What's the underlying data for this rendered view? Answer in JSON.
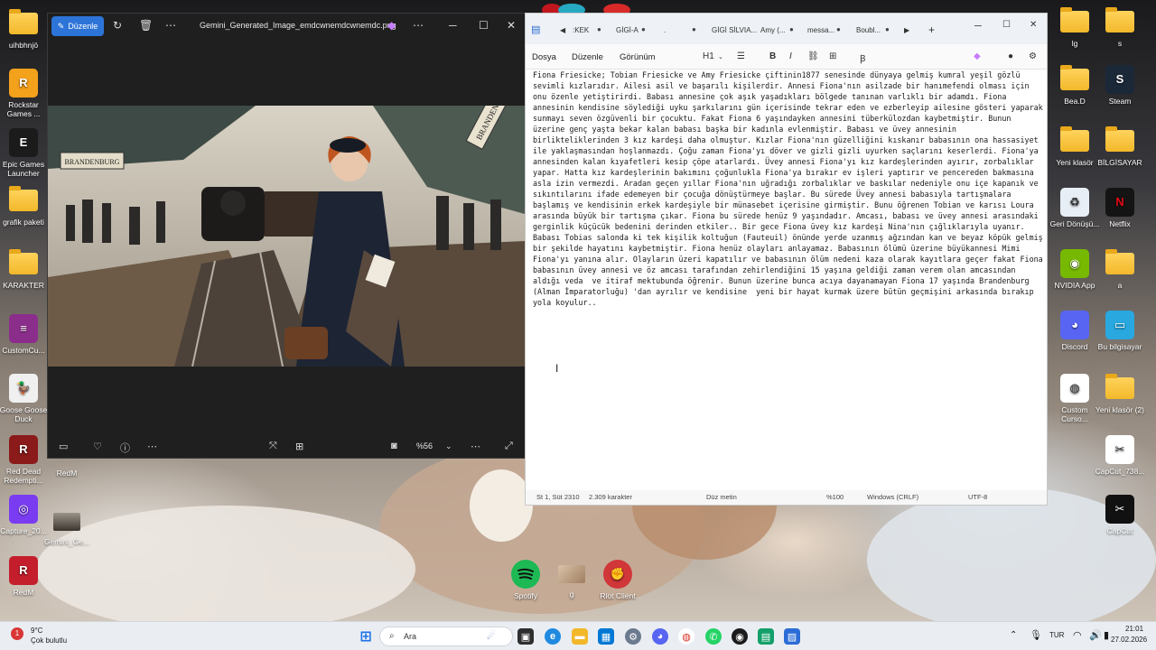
{
  "desktop": {
    "left_icons": [
      {
        "label": "uihbhnjö",
        "kind": "folder"
      },
      {
        "label": "Rockstar Games ...",
        "kind": "app",
        "icon": "rockstar-icon",
        "color": "#f4a11c",
        "glyph": "R"
      },
      {
        "label": "Epic Games Launcher",
        "kind": "app",
        "icon": "epic-games-icon",
        "color": "#1b1b1b",
        "glyph": "E"
      },
      {
        "label": "grafik paketi",
        "kind": "folder"
      },
      {
        "label": "KARAKTER",
        "kind": "folder"
      },
      {
        "label": "CustomCu...",
        "kind": "app",
        "icon": "winrar-icon",
        "color": "#8b2d8b",
        "glyph": "≡"
      },
      {
        "label": "Goose Goose Duck",
        "kind": "app",
        "icon": "goose-icon",
        "color": "#f0f0f0",
        "glyph": "🦆"
      },
      {
        "label": "Red Dead Redempti...",
        "kind": "app",
        "icon": "red-dead-icon",
        "color": "#8b1a1a",
        "glyph": "R"
      },
      {
        "label": "Capture_20...",
        "kind": "app",
        "icon": "capture-icon",
        "color": "#7a3cf0",
        "glyph": "◎"
      },
      {
        "label": "RedM",
        "kind": "app",
        "icon": "redm-icon",
        "color": "#c41e2c",
        "glyph": "R"
      }
    ],
    "mid_icons": [
      {
        "label": "RedM",
        "icon": "redm-icon"
      },
      {
        "label": "Gemini_Ge...",
        "icon": "image-file-icon"
      }
    ],
    "right_icons": [
      {
        "label": "lg",
        "kind": "folder"
      },
      {
        "label": "s",
        "kind": "folder"
      },
      {
        "label": "Bea.D",
        "kind": "folder"
      },
      {
        "label": "Steam",
        "kind": "app",
        "icon": "steam-icon",
        "color": "#1b2838",
        "glyph": "S"
      },
      {
        "label": "Yeni klasör",
        "kind": "folder"
      },
      {
        "label": "BİLGİSAYAR",
        "kind": "folder"
      },
      {
        "label": "Geri Dönüşü...",
        "kind": "app",
        "icon": "recycle-bin-icon",
        "color": "#e8eef5",
        "glyph": "♻"
      },
      {
        "label": "Netflix",
        "kind": "app",
        "icon": "netflix-icon",
        "color": "#141414",
        "glyph": "N"
      },
      {
        "label": "NVIDIA App",
        "kind": "app",
        "icon": "nvidia-icon",
        "color": "#76b900",
        "glyph": "◉"
      },
      {
        "label": "a",
        "kind": "folder"
      },
      {
        "label": "Discord",
        "kind": "app",
        "icon": "discord-icon",
        "color": "#5865f2",
        "glyph": "◕"
      },
      {
        "label": "Bu bilgisayar",
        "kind": "app",
        "icon": "this-pc-icon",
        "color": "#29a8e0",
        "glyph": "▭"
      },
      {
        "label": "Custom Curso...",
        "kind": "app",
        "icon": "chrome-icon",
        "color": "#ffffff",
        "glyph": "◍"
      },
      {
        "label": "Yeni klasör (2)",
        "kind": "folder"
      },
      {
        "label": "CapCut_738...",
        "kind": "app",
        "icon": "capcut-icon",
        "color": "#ffffff",
        "glyph": "✂"
      },
      {
        "label": "CapCut",
        "kind": "app",
        "icon": "capcut-icon",
        "color": "#111111",
        "glyph": "✂"
      }
    ],
    "bottom_icons": [
      {
        "label": "Spotify",
        "icon": "spotify-icon",
        "color": "#1db954"
      },
      {
        "label": "g",
        "icon": "image-file-icon",
        "color": "#d9c3a8"
      },
      {
        "label": "Riot Client",
        "icon": "riot-icon",
        "color": "#d13639"
      }
    ]
  },
  "photos_window": {
    "edit_label": "Düzenle",
    "filename": "Gemini_Generated_Image_emdcwnemdcwnemdc.png",
    "zoom": "%56",
    "sign_left": "BRANDENBURG",
    "sign_right": "BRANDENBURG Hbf"
  },
  "notepad_window": {
    "tabs": [
      ":KEK",
      "GİGİ-A",
      ".",
      "GİGİ SİLVIA...",
      "Amy (...",
      "messa...",
      "Boubl..."
    ],
    "menu": [
      "Dosya",
      "Düzenle",
      "Görünüm"
    ],
    "heading_level": "H1",
    "body_text": "Fiona Friesicke; Tobian Friesicke ve Amy Friesicke çiftinin1877 senesinde dünyaya gelmiş kumral yeşil gözlü sevimli kızlarıdır. Ailesi asil ve başarılı kişilerdir. Annesi Fiona'nın asilzade bir hanımefendi olması için onu özenle yetiştirirdi. Babası annesine çok aşık yaşadıkları bölgede tanınan varlıklı bir adamdı. Fiona annesinin kendisine söylediği uyku şarkılarını gün içerisinde tekrar eden ve ezberleyip ailesine gösteri yaparak sunmayı seven özgüvenli bir çocuktu. Fakat Fiona 6 yaşındayken annesini tüberkülozdan kaybetmiştir. Bunun üzerine genç yaşta bekar kalan babası başka bir kadınla evlenmiştir. Babası ve üvey annesinin birlikteliklerinden 3 kız kardeşi daha olmuştur. Kızlar Fiona'nın güzelliğini kıskanır babasının ona hassasiyet ile yaklaşmasından hoşlanmazdı. Çoğu zaman Fiona'yı döver ve gizli gizli uyurken saçlarını keserlerdi. Fiona'ya annesinden kalan kıyafetleri kesip çöpe atarlardı. Üvey annesi Fiona'yı kız kardeşlerinden ayırır, zorbalıklar yapar. Hatta kız kardeşlerinin bakımını çoğunlukla Fiona'ya bırakır ev işleri yaptırır ve pencereden bakmasına asla izin vermezdi. Aradan geçen yıllar Fiona'nın uğradığı zorbalıklar ve baskılar nedeniyle onu içe kapanık ve sıkıntılarını ifade edemeyen bir çocuğa dönüştürmeye başlar. Bu sürede Üvey annesi babasıyla tartışmalara başlamış ve kendisinin erkek kardeşiyle bir münasebet içerisine girmiştir. Bunu öğrenen Tobian ve karısı Loura arasında büyük bir tartışma çıkar. Fiona bu sürede henüz 9 yaşındadır. Amcası, babası ve üvey annesi arasındaki gerginlik küçücük bedenini derinden etkiler.. Bir gece Fiona üvey kız kardeşi Nina'nın çığlıklarıyla uyanır. Babası Tobias salonda ki tek kişilik koltuğun (Fauteuil) önünde yerde uzanmış ağzından kan ve beyaz köpük gelmiş bir şekilde hayatını kaybetmiştir. Fiona henüz olayları anlayamaz. Babasının ölümü üzerine büyükannesi Mimi Fiona'yı yanına alır. Olayların üzeri kapatılır ve babasının ölüm nedeni kaza olarak kayıtlara geçer fakat Fiona babasının üvey annesi ve öz amcası tarafından zehirlendiğini 15 yaşına geldiği zaman verem olan amcasından aldığı veda  ve itiraf mektubunda öğrenir. Bunun üzerine bunca acıya dayanamayan Fiona 17 yaşında Brandenburg (Alman İmparatorluğu) 'dan ayrılır ve kendisine  yeni bir hayat kurmak üzere bütün geçmişini arkasında bırakıp yola koyulur..",
    "status": {
      "position": "St 1, Süt 2310",
      "chars": "2.309 karakter",
      "format": "Düz metin",
      "zoom": "%100",
      "line_ending": "Windows (CRLF)",
      "encoding": "UTF-8"
    }
  },
  "taskbar": {
    "weather_temp": "9°C",
    "weather_desc": "Çok bulutlu",
    "search_placeholder": "Ara",
    "language": "TUR",
    "time": "21:01",
    "date": "27.02.2026"
  }
}
